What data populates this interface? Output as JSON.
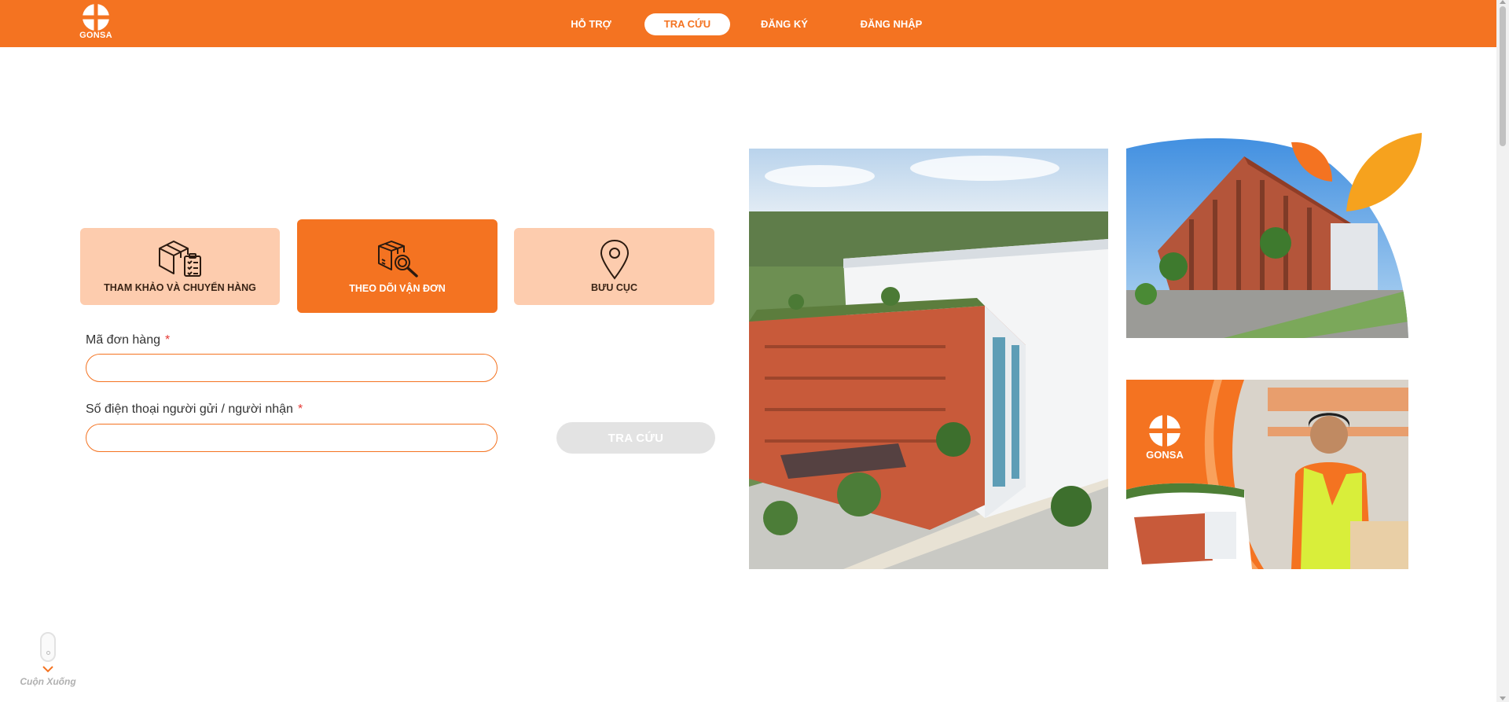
{
  "brand": {
    "name": "GONSA",
    "accent": "#f47321",
    "tab_light": "#fdccae",
    "leaf_orange": "#f6a21e"
  },
  "nav": {
    "items": [
      {
        "label": "HỖ TRỢ",
        "active": false
      },
      {
        "label": "TRA CỨU",
        "active": true
      },
      {
        "label": "ĐĂNG KÝ",
        "active": false
      },
      {
        "label": "ĐĂNG NHẬP",
        "active": false
      }
    ]
  },
  "tabs": [
    {
      "label": "THAM KHẢO VÀ CHUYỂN HÀNG",
      "icon": "box-clipboard-icon",
      "active": false
    },
    {
      "label": "THEO DÕI VẬN ĐƠN",
      "icon": "package-search-icon",
      "active": true
    },
    {
      "label": "BƯU CỤC",
      "icon": "location-pin-icon",
      "active": false
    }
  ],
  "form": {
    "order_label": "Mã đơn hàng",
    "order_value": "",
    "phone_label": "Số điện thoại người gửi / người nhận",
    "phone_value": "",
    "required_mark": "*",
    "submit_label": "TRA CỨU"
  },
  "promo": {
    "brand_text": "GONSA"
  },
  "scroll_hint": {
    "label": "Cuộn Xuống",
    "icon": "mouse-scroll-icon"
  }
}
